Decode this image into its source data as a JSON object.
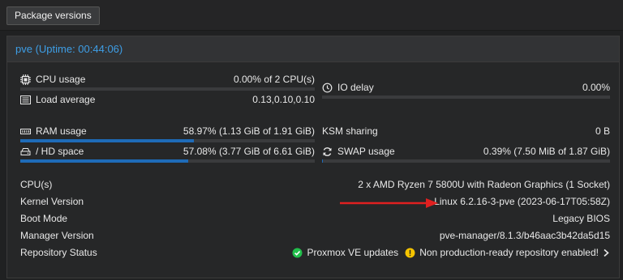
{
  "toolbar": {
    "package_versions": "Package versions"
  },
  "panel": {
    "title": "pve (Uptime: 00:44:06)"
  },
  "stats": {
    "cpu": {
      "label": "CPU usage",
      "value": "0.00% of 2 CPU(s)",
      "fraction": 0.0
    },
    "load": {
      "label": "Load average",
      "value": "0.13,0.10,0.10"
    },
    "io": {
      "label": "IO delay",
      "value": "0.00%",
      "fraction": 0.0
    },
    "ram": {
      "label": "RAM usage",
      "value": "58.97% (1.13 GiB of 1.91 GiB)",
      "fraction": 0.5897
    },
    "hd": {
      "label": "/ HD space",
      "value": "57.08% (3.77 GiB of 6.61 GiB)",
      "fraction": 0.5708
    },
    "ksm": {
      "label": "KSM sharing",
      "value": "0 B"
    },
    "swap": {
      "label": "SWAP usage",
      "value": "0.39% (7.50 MiB of 1.87 GiB)",
      "fraction": 0.0039
    }
  },
  "info": {
    "cpus": {
      "label": "CPU(s)",
      "value": "2 x AMD Ryzen 7 5800U with Radeon Graphics (1 Socket)"
    },
    "kernel": {
      "label": "Kernel Version",
      "value": "Linux 6.2.16-3-pve (2023-06-17T05:58Z)"
    },
    "boot": {
      "label": "Boot Mode",
      "value": "Legacy BIOS"
    },
    "manager": {
      "label": "Manager Version",
      "value": "pve-manager/8.1.3/b46aac3b42da5d15"
    },
    "repo": {
      "label": "Repository Status",
      "ok_text": "Proxmox VE updates",
      "warn_text": "Non production-ready repository enabled!"
    }
  },
  "colors": {
    "accent": "#3e9ee6",
    "bar_fill": "#1e6bb8",
    "ok": "#21bf4b",
    "warn": "#f5c400",
    "arrow": "#e02020"
  }
}
